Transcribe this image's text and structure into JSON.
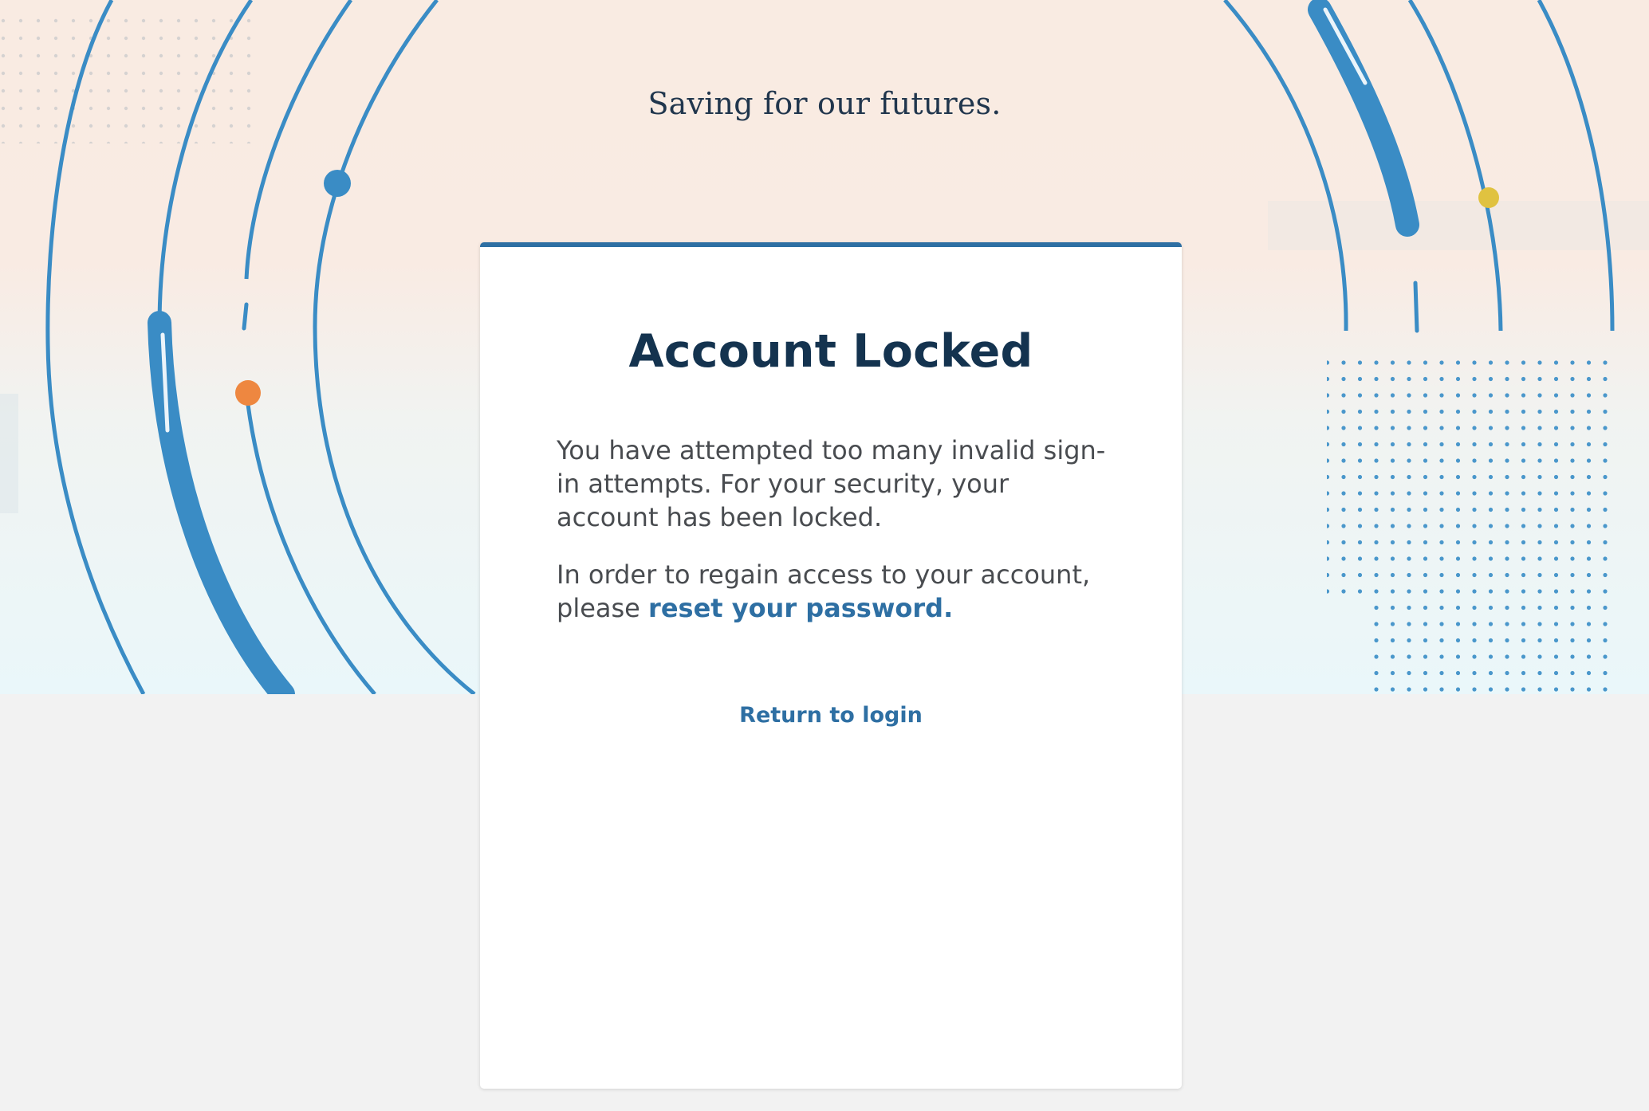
{
  "header": {
    "tagline": "Saving for our futures."
  },
  "card": {
    "title": "Account Locked",
    "message": "You have attempted too many invalid sign-in attempts. For your security, your account has been locked.",
    "regain_prefix": "In order to regain access to your account, please ",
    "reset_link": "reset your password.",
    "return_link": "Return to login"
  },
  "colors": {
    "accent": "#2e6fa3",
    "title": "#14334f",
    "arc_blue": "#3b8cc6",
    "dot_orange": "#ee8740",
    "dot_yellow": "#e0c240",
    "page_background": "#f2f2f2"
  }
}
